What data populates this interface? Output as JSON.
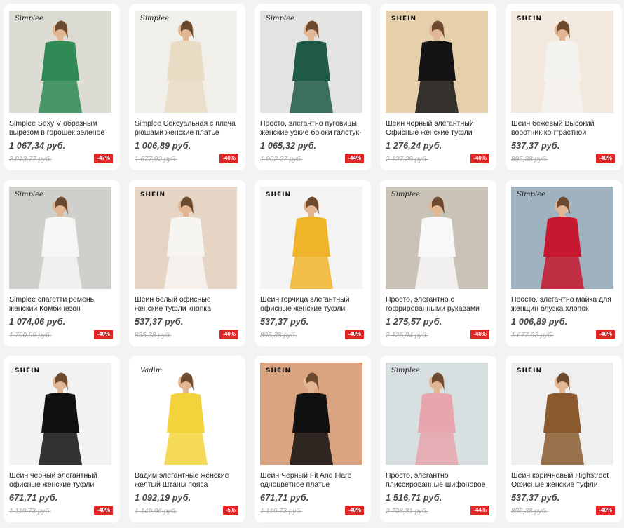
{
  "products": [
    {
      "brand": "Simplee",
      "title": "Simplee Sexy V образным вырезом в горошек зеленое",
      "price": "1 067,34 руб.",
      "old_price": "2 013,77 руб.",
      "discount": "-47%",
      "bg": "#dcdcd4",
      "color": "#2f8a55"
    },
    {
      "brand": "Simplee",
      "title": "Simplee Сексуальная с плеча рюшами женские платье",
      "price": "1 006,89 руб.",
      "old_price": "1 677,92 руб.",
      "discount": "-40%",
      "bg": "#f1efea",
      "color": "#e8dcc4"
    },
    {
      "brand": "Simplee",
      "title": "Просто, элегантно пуговицы женские узкие брюки галстук-",
      "price": "1 065,32 руб.",
      "old_price": "1 902,27 руб.",
      "discount": "-44%",
      "bg": "#e3e3e1",
      "color": "#1f5a48"
    },
    {
      "brand": "SHEIN",
      "title": "Шеин черный элегантный Офисные женские туфли",
      "price": "1 276,24 руб.",
      "old_price": "2 127,29 руб.",
      "discount": "-40%",
      "bg": "#e6cfab",
      "color": "#141414"
    },
    {
      "brand": "SHEIN",
      "title": "Шеин бежевый Высокий воротник контрастной",
      "price": "537,37 руб.",
      "old_price": "895,38 руб.",
      "discount": "-40%",
      "bg": "#f3e8de",
      "color": "#f4f2ee"
    },
    {
      "brand": "Simplee",
      "title": "Simplee спагетти ремень женский Комбинезон",
      "price": "1 074,06 руб.",
      "old_price": "1 790,09 руб.",
      "discount": "-40%",
      "bg": "#cfcfcc",
      "color": "#f6f6f4"
    },
    {
      "brand": "SHEIN",
      "title": "Шеин белый офисные женские туфли кнопка",
      "price": "537,37 руб.",
      "old_price": "895,38 руб.",
      "discount": "-40%",
      "bg": "#e6d5c5",
      "color": "#f7f5f1"
    },
    {
      "brand": "SHEIN",
      "title": "Шеин горчица элегантный офисные женские туфли",
      "price": "537,37 руб.",
      "old_price": "895,38 руб.",
      "discount": "-40%",
      "bg": "#f4f4f4",
      "color": "#f0b42a"
    },
    {
      "brand": "Simplee",
      "title": "Просто, элегантно с гофрированными рукавами",
      "price": "1 275,57 руб.",
      "old_price": "2 125,94 руб.",
      "discount": "-40%",
      "bg": "#c9c2b6",
      "color": "#f8f8f8"
    },
    {
      "brand": "Simplee",
      "title": "Просто, элегантно майка для женщин блузка хлопок",
      "price": "1 006,89 руб.",
      "old_price": "1 677,92 руб.",
      "discount": "-40%",
      "bg": "#9fb2c0",
      "color": "#c6182e"
    },
    {
      "brand": "SHEIN",
      "title": "Шеин черный элегантный офисные женские туфли",
      "price": "671,71 руб.",
      "old_price": "1 119,73 руб.",
      "discount": "-40%",
      "bg": "#f2f2f2",
      "color": "#111111"
    },
    {
      "brand": "Vadim",
      "title": "Вадим элегантные женские желтый Штаны пояса карманы",
      "price": "1 092,19 руб.",
      "old_price": "1 149,96 руб.",
      "discount": "-5%",
      "bg": "#ffffff",
      "color": "#f2d43a"
    },
    {
      "brand": "SHEIN",
      "title": "Шеин Черный Fit And Flare одноцветное платье",
      "price": "671,71 руб.",
      "old_price": "1 119,73 руб.",
      "discount": "-40%",
      "bg": "#d9a47f",
      "color": "#111111"
    },
    {
      "brand": "Simplee",
      "title": "Просто, элегантно плиссированные шифоновое",
      "price": "1 516,71 руб.",
      "old_price": "2 708,31 руб.",
      "discount": "-44%",
      "bg": "#d8dfe0",
      "color": "#e7a6ad"
    },
    {
      "brand": "SHEIN",
      "title": "Шеин коричневый Highstreet Офисные женские туфли",
      "price": "537,37 руб.",
      "old_price": "895,38 руб.",
      "discount": "-40%",
      "bg": "#efefef",
      "color": "#8a5a2e"
    }
  ]
}
